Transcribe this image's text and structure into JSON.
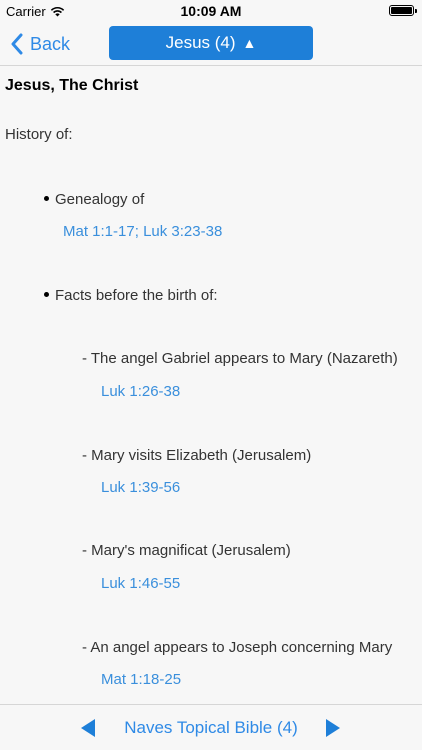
{
  "status_bar": {
    "carrier": "Carrier",
    "time": "10:09 AM"
  },
  "nav": {
    "back_label": "Back",
    "title": "Jesus (4)",
    "title_arrow": "▲"
  },
  "content": {
    "heading": "Jesus, The Christ",
    "subhead": "History of:",
    "sections": [
      {
        "label": "Genealogy of",
        "refs": [
          "Mat 1:1-17",
          "Luk 3:23-38"
        ],
        "ref_sep": "; "
      },
      {
        "label": "Facts before the birth of:"
      }
    ],
    "items": [
      {
        "label": "- The angel Gabriel appears to Mary (Nazareth)",
        "ref": "Luk 1:26-38"
      },
      {
        "label": "- Mary visits Elizabeth (Jerusalem)",
        "ref": "Luk 1:39-56"
      },
      {
        "label": "- Mary's magnificat (Jerusalem)",
        "ref": "Luk 1:46-55"
      },
      {
        "label": "- An angel appears to Joseph concerning Mary",
        "ref": "Mat 1:18-25"
      }
    ]
  },
  "toolbar": {
    "label": "Naves Topical Bible (4)"
  },
  "colors": {
    "accent": "#2f8ae6",
    "title_bg": "#1e7fd8",
    "link": "#3a8fdc"
  }
}
